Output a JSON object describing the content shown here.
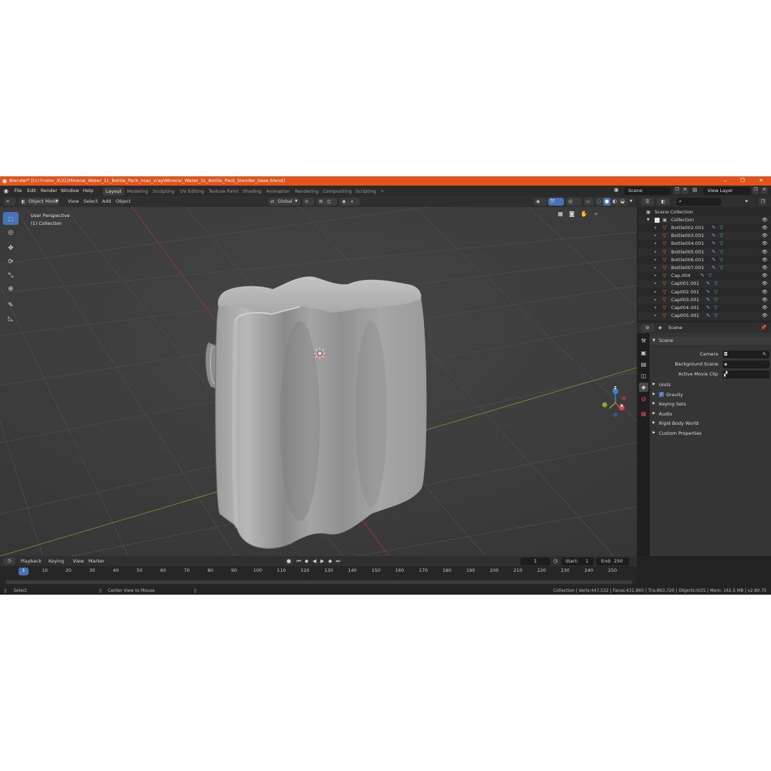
{
  "window": {
    "title": "Blender* [I:\\!!!conv_3\\31\\Mineral_Water_1L_Bottle_Pack_max_vray\\Mineral_Water_1L_Bottle_Pack_blender_base.blend]",
    "minimize": "–",
    "maximize": "❐",
    "close": "✕"
  },
  "menus": [
    "File",
    "Edit",
    "Render",
    "Window",
    "Help"
  ],
  "workspaces": [
    "Layout",
    "Modeling",
    "Sculpting",
    "UV Editing",
    "Texture Paint",
    "Shading",
    "Animation",
    "Rendering",
    "Compositing",
    "Scripting"
  ],
  "add_workspace": "+",
  "scene_field": "Scene",
  "view_layer_field": "View Layer",
  "viewport_header": {
    "mode": "Object Mode",
    "menus": [
      "View",
      "Select",
      "Add",
      "Object"
    ],
    "orientation": "Global"
  },
  "viewport": {
    "perspective": "User Perspective",
    "collection": "(1) Collection",
    "gizmo": {
      "z": "Z",
      "x": "X"
    }
  },
  "outliner": {
    "root": "Scene Collection",
    "collection": "Collection",
    "items": [
      "Bottle002.001",
      "Bottle003.001",
      "Bottle004.001",
      "Bottle005.001",
      "Bottle006.001",
      "Bottle007.001",
      "Cap.004",
      "Cap001.001",
      "Cap002.001",
      "Cap003.001",
      "Cap004.001",
      "Cap005.001"
    ]
  },
  "properties": {
    "context": "Scene",
    "panel": "Scene",
    "fields": [
      "Camera",
      "Background Scene",
      "Active Movie Clip"
    ],
    "subpanels": [
      "Units",
      "Gravity",
      "Keying Sets",
      "Audio",
      "Rigid Body World",
      "Custom Properties"
    ]
  },
  "timeline": {
    "menus": [
      "Playback",
      "Keying",
      "View",
      "Marker"
    ],
    "current_frame": "1",
    "start_label": "Start:",
    "start": "1",
    "end_label": "End:",
    "end": "250",
    "ticks": [
      "1",
      "10",
      "20",
      "30",
      "40",
      "50",
      "60",
      "70",
      "80",
      "90",
      "100",
      "110",
      "120",
      "130",
      "140",
      "150",
      "160",
      "170",
      "180",
      "190",
      "200",
      "210",
      "220",
      "230",
      "240",
      "250"
    ]
  },
  "status": {
    "select": "Select",
    "center_view": "Center View to Mouse",
    "stats": "Collection | Verts:447,532 | Faces:431,860 | Tris:863,720 | Objects:0/25 | Mem: 162.5 MB | v2.80.75"
  },
  "colors": {
    "title_bar": "#e3531c",
    "accent": "#4772b3",
    "mesh_icon": "#e0883a",
    "modifier_icon": "#4fc3b5",
    "x_axis": "#d64550",
    "y_axis": "#7fae3a",
    "z_axis": "#3a7fd6"
  },
  "icons": [
    "blender-logo",
    "select-box-tool",
    "cursor-tool",
    "move-tool",
    "rotate-tool",
    "scale-tool",
    "transform-tool",
    "annotate-tool",
    "measure-tool",
    "eye-icon",
    "pin-icon",
    "play-icon"
  ]
}
